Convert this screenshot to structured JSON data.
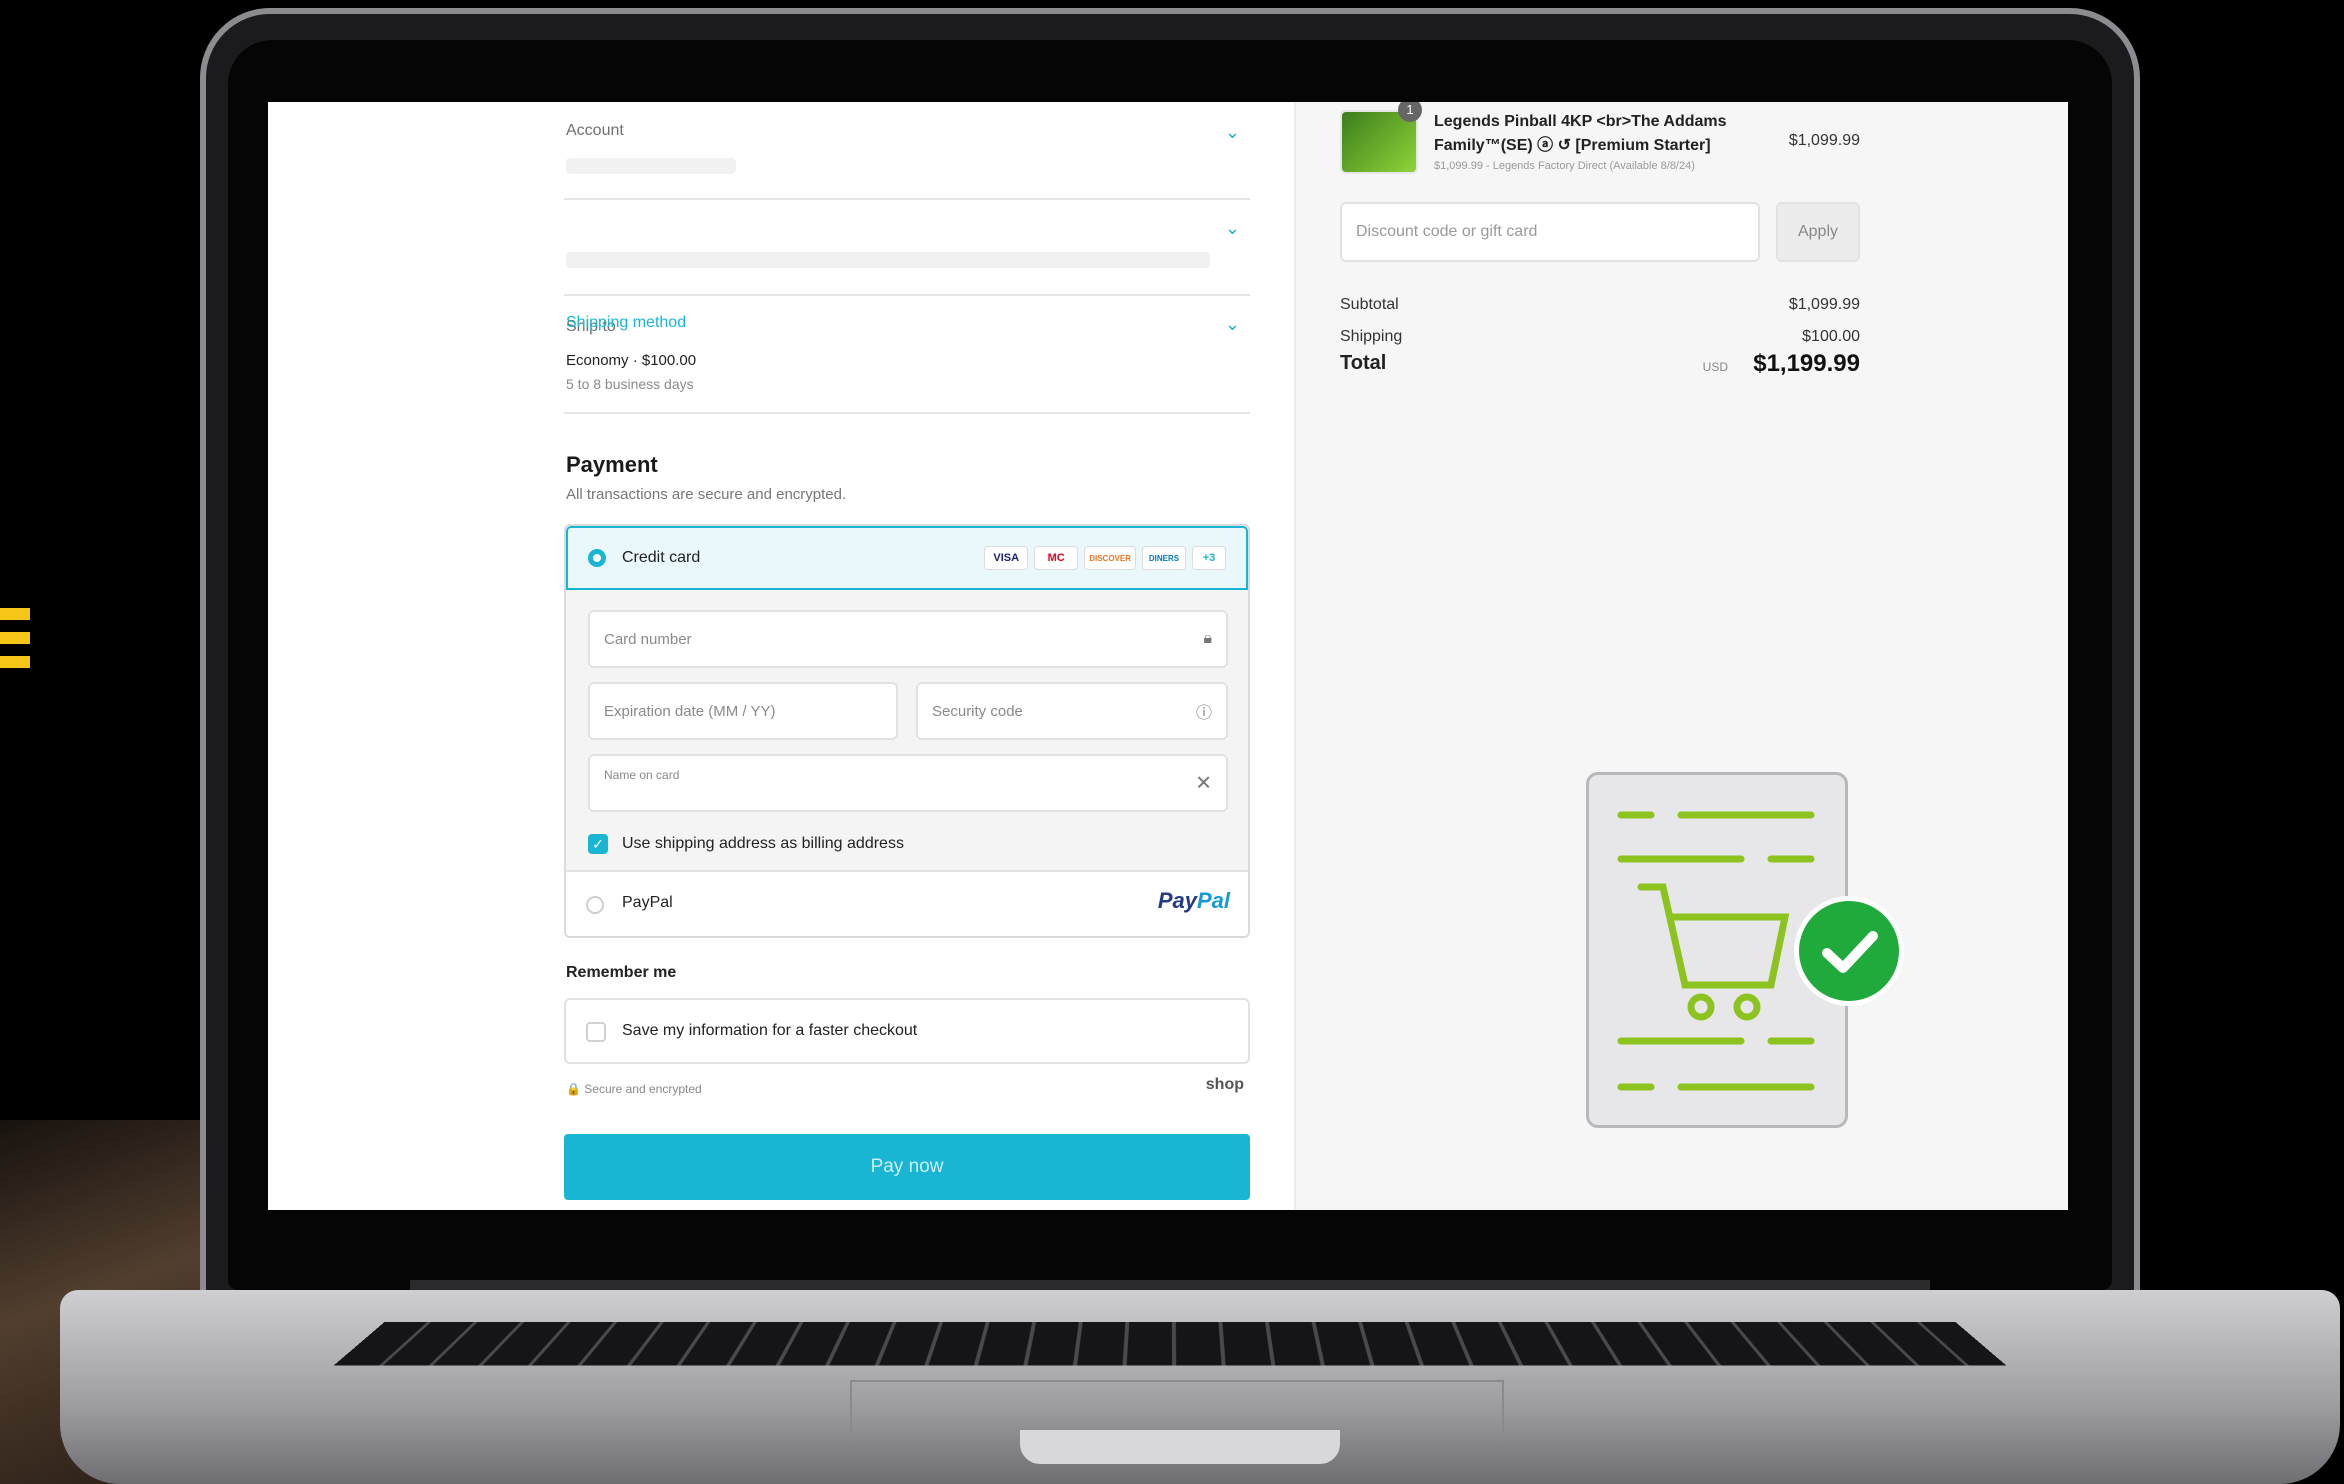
{
  "checkout": {
    "account_label": "Account",
    "ship_to_label": "Ship to",
    "shipping_method_label": "Shipping method",
    "shipping_method_name": "Economy · $100.00",
    "shipping_method_days": "5 to 8 business days",
    "payment_title": "Payment",
    "payment_subtitle": "All transactions are secure and encrypted.",
    "credit_card_label": "Credit card",
    "card_brands": [
      "VISA",
      "MC",
      "DISCOVER",
      "DINERS",
      "+3"
    ],
    "card_number_placeholder": "Card number",
    "expiration_placeholder": "Expiration date (MM / YY)",
    "security_code_placeholder": "Security code",
    "name_on_card_placeholder": "Name on card",
    "billing_checkbox_label": "Use shipping address as billing address",
    "paypal_label": "PayPal",
    "paypal_logo_a": "Pay",
    "paypal_logo_b": "Pal",
    "remember_title": "Remember me",
    "save_info_label": "Save my information for a faster checkout",
    "secure_note": "🔒 Secure and encrypted",
    "shop_label": "shop",
    "pay_now_label": "Pay now"
  },
  "summary": {
    "quantity_badge": "1",
    "product_title": "Legends Pinball 4KP <br>The Addams Family™(SE) ⓐ ↺ [Premium Starter]",
    "product_subtitle": "$1,099.99 - Legends Factory Direct (Available 8/8/24)",
    "product_price": "$1,099.99",
    "discount_placeholder": "Discount code or gift card",
    "apply_label": "Apply",
    "subtotal_label": "Subtotal",
    "subtotal_value": "$1,099.99",
    "shipping_label": "Shipping",
    "shipping_value": "$100.00",
    "total_label": "Total",
    "currency": "USD",
    "total_value": "$1,199.99"
  },
  "colors": {
    "accent": "#19b6d4",
    "success_green": "#1faa3b",
    "illustration_green": "#8cc31e"
  }
}
